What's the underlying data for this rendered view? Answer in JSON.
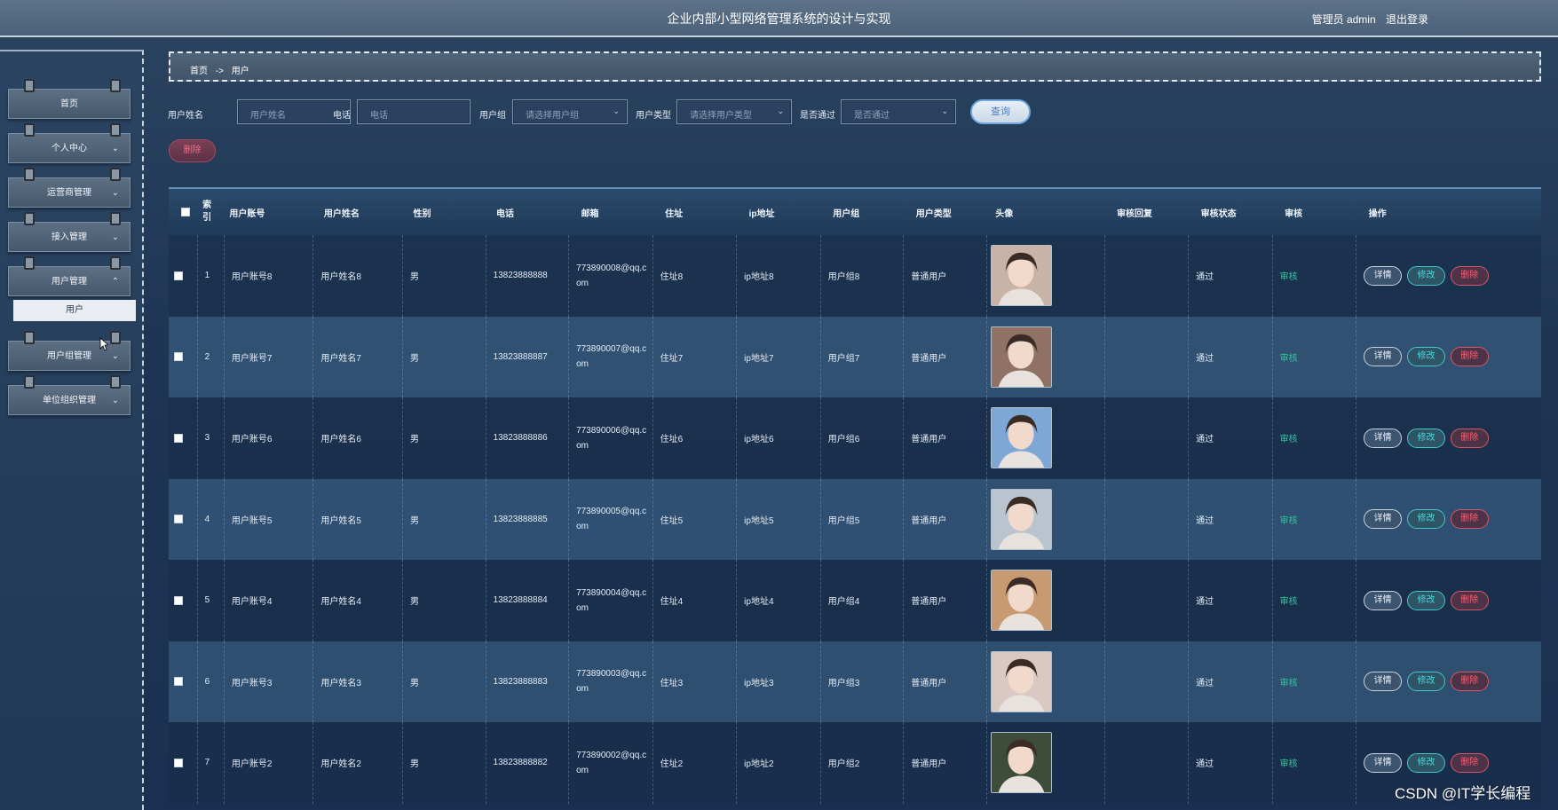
{
  "header": {
    "title": "企业内部小型网络管理系统的设计与实现",
    "user_label": "管理员 admin",
    "logout_label": "退出登录"
  },
  "sidebar": {
    "items": [
      {
        "label": "首页",
        "has_chevron": false
      },
      {
        "label": "个人中心",
        "has_chevron": true
      },
      {
        "label": "运营商管理",
        "has_chevron": true
      },
      {
        "label": "接入管理",
        "has_chevron": true
      },
      {
        "label": "用户管理",
        "has_chevron": true,
        "expanded": true
      },
      {
        "label": "用户组管理",
        "has_chevron": true
      },
      {
        "label": "单位组织管理",
        "has_chevron": true
      }
    ],
    "sub_item": "用户"
  },
  "breadcrumb": {
    "home": "首页",
    "separator": "->",
    "current": "用户"
  },
  "search": {
    "name_label": "用户姓名",
    "name_placeholder": "用户姓名",
    "phone_label": "电话",
    "phone_placeholder": "电话",
    "group_label": "用户组",
    "group_value": "请选择用户组",
    "type_label": "用户类型",
    "type_value": "请选择用户类型",
    "pass_label": "是否通过",
    "pass_value": "是否通过",
    "query_button": "查询",
    "delete_button": "删除"
  },
  "table": {
    "columns": [
      "",
      "索引",
      "用户账号",
      "用户姓名",
      "性别",
      "电话",
      "邮箱",
      "住址",
      "ip地址",
      "用户组",
      "用户类型",
      "头像",
      "审核回复",
      "审核状态",
      "审核",
      "操作"
    ],
    "col_index_line1": "索",
    "col_index_line2": "引",
    "rows": [
      {
        "index": "1",
        "account": "用户账号8",
        "name": "用户姓名8",
        "gender": "男",
        "phone": "13823888888",
        "email": "773890008@qq.com",
        "address": "住址8",
        "ip": "ip地址8",
        "group": "用户组8",
        "type": "普通用户",
        "reply": "",
        "status": "通过",
        "audit": "审核"
      },
      {
        "index": "2",
        "account": "用户账号7",
        "name": "用户姓名7",
        "gender": "男",
        "phone": "13823888887",
        "email": "773890007@qq.com",
        "address": "住址7",
        "ip": "ip地址7",
        "group": "用户组7",
        "type": "普通用户",
        "reply": "",
        "status": "通过",
        "audit": "审核"
      },
      {
        "index": "3",
        "account": "用户账号6",
        "name": "用户姓名6",
        "gender": "男",
        "phone": "13823888886",
        "email": "773890006@qq.com",
        "address": "住址6",
        "ip": "ip地址6",
        "group": "用户组6",
        "type": "普通用户",
        "reply": "",
        "status": "通过",
        "audit": "审核"
      },
      {
        "index": "4",
        "account": "用户账号5",
        "name": "用户姓名5",
        "gender": "男",
        "phone": "13823888885",
        "email": "773890005@qq.com",
        "address": "住址5",
        "ip": "ip地址5",
        "group": "用户组5",
        "type": "普通用户",
        "reply": "",
        "status": "通过",
        "audit": "审核"
      },
      {
        "index": "5",
        "account": "用户账号4",
        "name": "用户姓名4",
        "gender": "男",
        "phone": "13823888884",
        "email": "773890004@qq.com",
        "address": "住址4",
        "ip": "ip地址4",
        "group": "用户组4",
        "type": "普通用户",
        "reply": "",
        "status": "通过",
        "audit": "审核"
      },
      {
        "index": "6",
        "account": "用户账号3",
        "name": "用户姓名3",
        "gender": "男",
        "phone": "13823888883",
        "email": "773890003@qq.com",
        "address": "住址3",
        "ip": "ip地址3",
        "group": "用户组3",
        "type": "普通用户",
        "reply": "",
        "status": "通过",
        "audit": "审核"
      },
      {
        "index": "7",
        "account": "用户账号2",
        "name": "用户姓名2",
        "gender": "男",
        "phone": "13823888882",
        "email": "773890002@qq.com",
        "address": "住址2",
        "ip": "ip地址2",
        "group": "用户组2",
        "type": "普通用户",
        "reply": "",
        "status": "通过",
        "audit": "审核"
      }
    ],
    "actions": {
      "detail": "详情",
      "edit": "修改",
      "delete": "删除"
    }
  },
  "avatar_colors": [
    "#c9b3a6",
    "#8f7263",
    "#7fa7d6",
    "#b9c4cf",
    "#c79a72",
    "#d9c9c2",
    "#3e4d3a"
  ],
  "watermark": "CSDN @IT学长编程",
  "colors": {
    "accent": "#6fa9df",
    "edit": "#43c7c9",
    "delete": "#ff5b6f",
    "audit": "#35c39b"
  }
}
